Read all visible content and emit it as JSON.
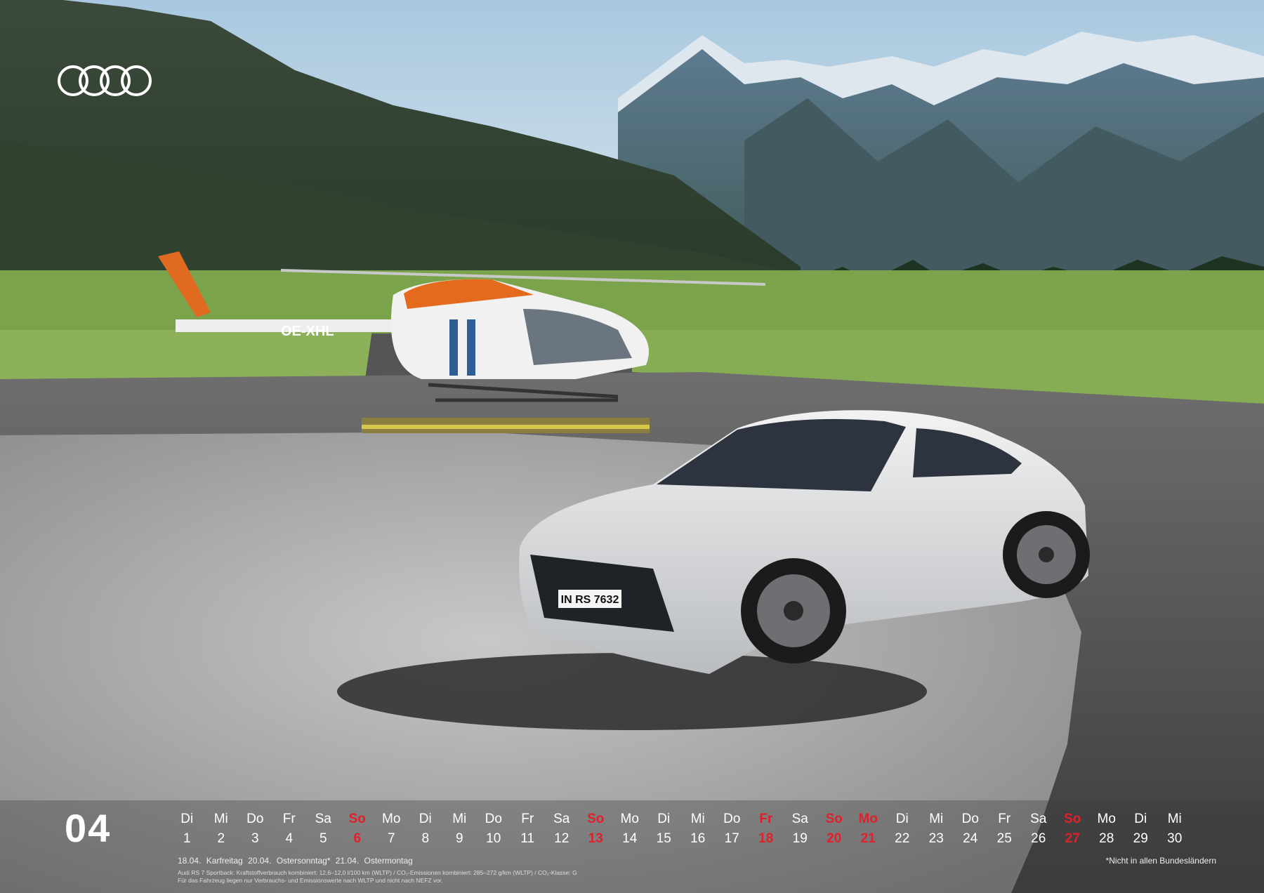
{
  "brand": {
    "logo_icon": "audi-four-rings-logo",
    "logo_color": "#ffffff"
  },
  "calendar": {
    "month": "04",
    "accent_color": "#e0202a",
    "days": [
      {
        "wd": "Di",
        "d": "1",
        "h": false
      },
      {
        "wd": "Mi",
        "d": "2",
        "h": false
      },
      {
        "wd": "Do",
        "d": "3",
        "h": false
      },
      {
        "wd": "Fr",
        "d": "4",
        "h": false
      },
      {
        "wd": "Sa",
        "d": "5",
        "h": false
      },
      {
        "wd": "So",
        "d": "6",
        "h": true
      },
      {
        "wd": "Mo",
        "d": "7",
        "h": false
      },
      {
        "wd": "Di",
        "d": "8",
        "h": false
      },
      {
        "wd": "Mi",
        "d": "9",
        "h": false
      },
      {
        "wd": "Do",
        "d": "10",
        "h": false
      },
      {
        "wd": "Fr",
        "d": "11",
        "h": false
      },
      {
        "wd": "Sa",
        "d": "12",
        "h": false
      },
      {
        "wd": "So",
        "d": "13",
        "h": true
      },
      {
        "wd": "Mo",
        "d": "14",
        "h": false
      },
      {
        "wd": "Di",
        "d": "15",
        "h": false
      },
      {
        "wd": "Mi",
        "d": "16",
        "h": false
      },
      {
        "wd": "Do",
        "d": "17",
        "h": false
      },
      {
        "wd": "Fr",
        "d": "18",
        "h": true
      },
      {
        "wd": "Sa",
        "d": "19",
        "h": false
      },
      {
        "wd": "So",
        "d": "20",
        "h": true
      },
      {
        "wd": "Mo",
        "d": "21",
        "h": true
      },
      {
        "wd": "Di",
        "d": "22",
        "h": false
      },
      {
        "wd": "Mi",
        "d": "23",
        "h": false
      },
      {
        "wd": "Do",
        "d": "24",
        "h": false
      },
      {
        "wd": "Fr",
        "d": "25",
        "h": false
      },
      {
        "wd": "Sa",
        "d": "26",
        "h": false
      },
      {
        "wd": "So",
        "d": "27",
        "h": true
      },
      {
        "wd": "Mo",
        "d": "28",
        "h": false
      },
      {
        "wd": "Di",
        "d": "29",
        "h": false
      },
      {
        "wd": "Mi",
        "d": "30",
        "h": false
      }
    ],
    "holidays": "18.04. Karfreitag   20.04. Ostersonntag*   21.04. Ostermontag",
    "footnote": "*Nicht in allen Bundesländern",
    "legal_line1": "Audi RS 7 Sportback: Kraftstoffverbrauch kombiniert: 12,6–12,0 l/100 km (WLTP) / CO₂-Emissionen kombiniert: 285–272 g/km (WLTP) / CO₂-Klasse: G",
    "legal_line2": "Für das Fahrzeug liegen nur Verbrauchs- und Emissionswerte nach WLTP und nicht nach NEFZ vor."
  },
  "photo": {
    "helicopter_registration": "OE-XHL",
    "license_plate": "IN RS 7632"
  }
}
